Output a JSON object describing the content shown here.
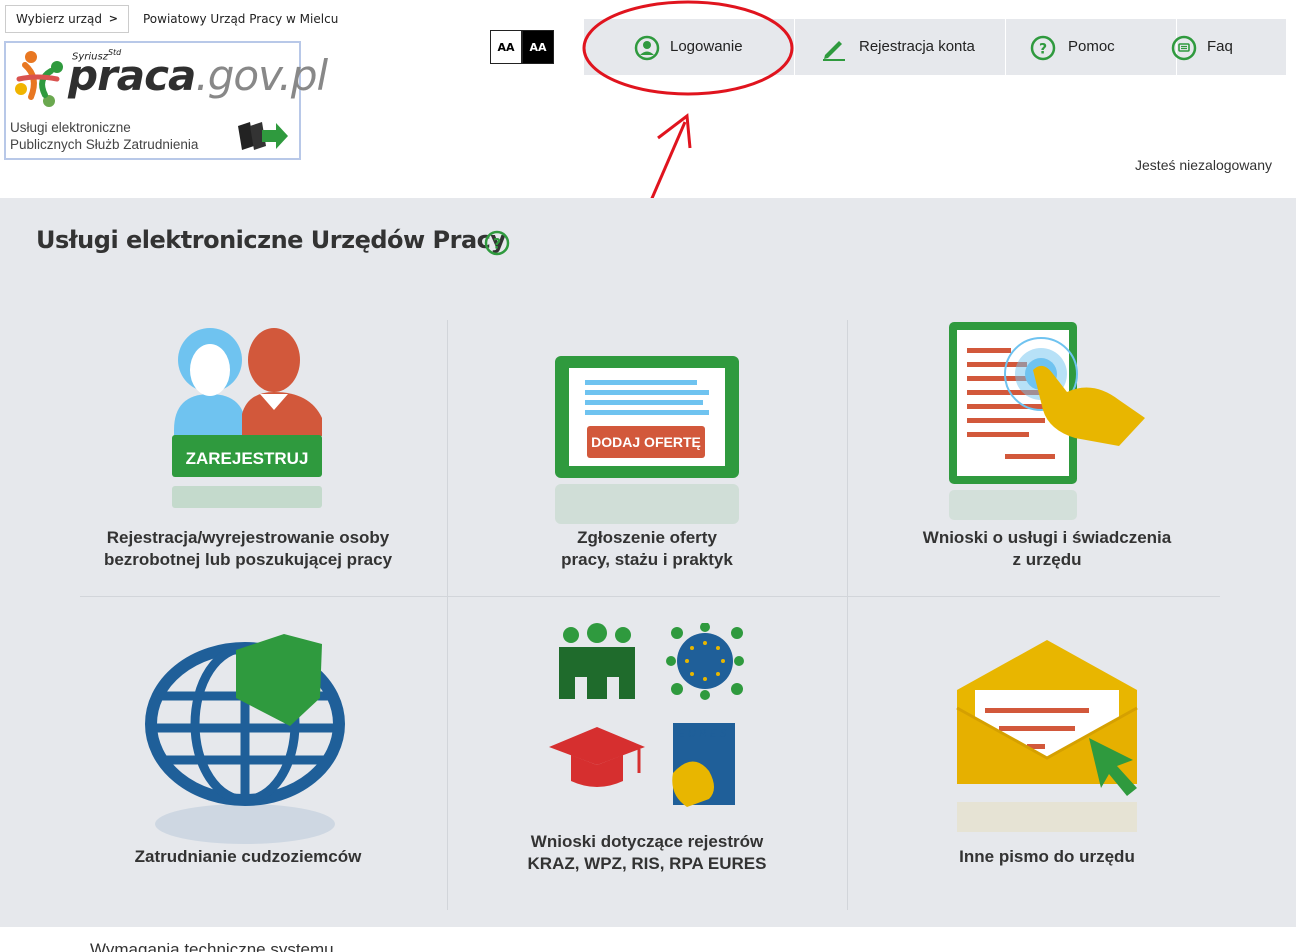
{
  "header": {
    "office_select_label": "Wybierz urząd",
    "office_name": "Powiatowy Urząd Pracy w Mielcu",
    "logo": {
      "superscript": "Syriusz",
      "superscript_sup": "Std",
      "main_1": "praca",
      "main_2": ".gov.pl",
      "subtitle_line1": "Usługi elektroniczne",
      "subtitle_line2": "Publicznych Służb Zatrudnienia"
    },
    "font_size_buttons": [
      {
        "label": "AA",
        "variant": "light"
      },
      {
        "label": "AA",
        "variant": "dark"
      }
    ],
    "nav": [
      {
        "label": "Logowanie",
        "icon": "user-circle-icon"
      },
      {
        "label": "Rejestracja konta",
        "icon": "pencil-icon"
      },
      {
        "label": "Pomoc",
        "icon": "question-circle-icon"
      },
      {
        "label": "Faq",
        "icon": "chat-bubble-icon"
      }
    ],
    "login_status": "Jesteś niezalogowany"
  },
  "main": {
    "title": "Usługi elektroniczne Urzędów Pracy",
    "tiles": [
      {
        "caption_line1": "Rejestracja/wyrejestrowanie osoby",
        "caption_line2": "bezrobotnej lub poszukującej pracy",
        "badge": "ZAREJESTRUJ",
        "icon": "people-register-icon"
      },
      {
        "caption_line1": "Zgłoszenie oferty",
        "caption_line2": "pracy, stażu i praktyk",
        "badge": "DODAJ OFERTĘ",
        "icon": "job-offer-board-icon"
      },
      {
        "caption_line1": "Wnioski o usługi i świadczenia",
        "caption_line2": "z urzędu",
        "icon": "document-touch-icon"
      },
      {
        "caption_line1": "Zatrudnianie cudzoziemców",
        "caption_line2": "",
        "icon": "globe-poland-icon"
      },
      {
        "caption_line1": "Wnioski dotyczące rejestrów",
        "caption_line2": "KRAZ, WPZ, RIS, RPA EURES",
        "eures_label": "EURES",
        "icon": "registers-icon"
      },
      {
        "caption_line1": "Inne pismo do urzędu",
        "caption_line2": "",
        "icon": "envelope-icon"
      }
    ]
  },
  "footer": {
    "text": "Wymagania techniczne systemu"
  },
  "colors": {
    "green": "#2f9a3e",
    "red_orange": "#d2583b",
    "blue": "#1f5f99",
    "yellow": "#e8b600",
    "panel_bg": "#e6e8ec",
    "annotation_red": "#e0141e"
  }
}
